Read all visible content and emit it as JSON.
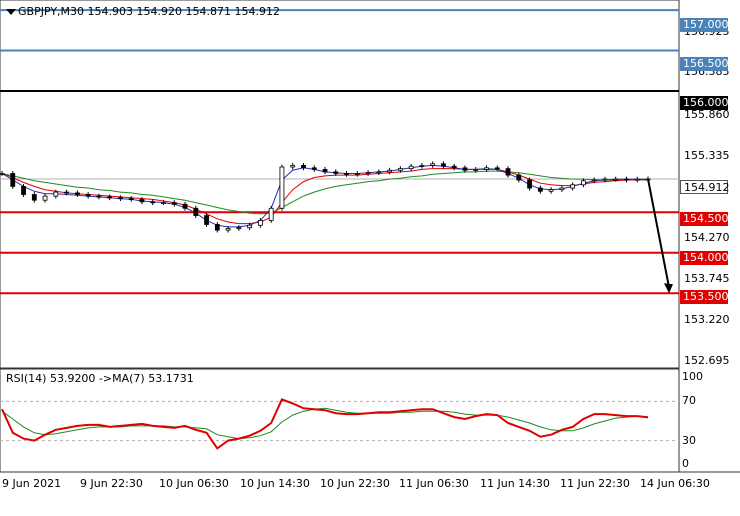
{
  "header": {
    "symbol_line": "GBPJPY,M30  154.903 154.920 154.871 154.912"
  },
  "rsi_header": {
    "label": "RSI(14) 53.9200  ->MA(7) 53.1731"
  },
  "price_axis": {
    "ticks": [
      "156.925",
      "156.385",
      "155.860",
      "155.335",
      "154.270",
      "153.745",
      "153.220",
      "152.695"
    ]
  },
  "price_badges": [
    {
      "label": "157.000",
      "kind": "blue"
    },
    {
      "label": "156.500",
      "kind": "blue"
    },
    {
      "label": "156.000",
      "kind": "black"
    },
    {
      "label": "154.912",
      "kind": "current"
    },
    {
      "label": "154.500",
      "kind": "red"
    },
    {
      "label": "154.000",
      "kind": "red"
    },
    {
      "label": "153.500",
      "kind": "red"
    }
  ],
  "rsi_axis": {
    "ticks": [
      "100",
      "70",
      "30",
      "0"
    ]
  },
  "time_axis": {
    "labels": [
      "9 Jun 2021",
      "9 Jun 22:30",
      "10 Jun 06:30",
      "10 Jun 14:30",
      "10 Jun 22:30",
      "11 Jun 06:30",
      "11 Jun 14:30",
      "11 Jun 22:30",
      "14 Jun 06:30"
    ]
  },
  "chart_data": {
    "type": "line",
    "symbol": "GBPJPY",
    "timeframe": "M30",
    "ohlc_header": {
      "open": 154.903,
      "high": 154.92,
      "low": 154.871,
      "close": 154.912
    },
    "horizontal_levels": [
      {
        "price": 157.0,
        "color": "#4a83b8"
      },
      {
        "price": 156.5,
        "color": "#4a83b8"
      },
      {
        "price": 156.0,
        "color": "#000000"
      },
      {
        "price": 154.5,
        "color": "#e00000"
      },
      {
        "price": 154.0,
        "color": "#e00000"
      },
      {
        "price": 153.5,
        "color": "#e00000"
      }
    ],
    "forecast_arrow": {
      "from": 154.912,
      "to": 153.5
    },
    "price_ylim": [
      152.6,
      157.1
    ],
    "x_labels": [
      "9 Jun 2021",
      "9 Jun 22:30",
      "10 Jun 06:30",
      "10 Jun 14:30",
      "10 Jun 22:30",
      "11 Jun 06:30",
      "11 Jun 14:30",
      "11 Jun 22:30",
      "14 Jun 06:30"
    ],
    "close_series": [
      154.98,
      154.82,
      154.72,
      154.65,
      154.7,
      154.75,
      154.74,
      154.72,
      154.7,
      154.69,
      154.68,
      154.67,
      154.66,
      154.63,
      154.62,
      154.62,
      154.6,
      154.55,
      154.46,
      154.35,
      154.28,
      154.3,
      154.31,
      154.34,
      154.4,
      154.55,
      155.06,
      155.08,
      155.05,
      155.03,
      155.0,
      154.98,
      154.97,
      154.98,
      154.99,
      155.0,
      155.02,
      155.04,
      155.07,
      155.08,
      155.1,
      155.07,
      155.05,
      155.02,
      155.03,
      155.05,
      155.04,
      154.96,
      154.9,
      154.8,
      154.76,
      154.78,
      154.8,
      154.84,
      154.89,
      154.9,
      154.91,
      154.91,
      154.9,
      154.91,
      154.912
    ],
    "ma_fast": [
      154.98,
      154.9,
      154.82,
      154.76,
      154.73,
      154.73,
      154.72,
      154.71,
      154.7,
      154.69,
      154.68,
      154.67,
      154.66,
      154.64,
      154.63,
      154.62,
      154.6,
      154.56,
      154.49,
      154.4,
      154.34,
      154.32,
      154.32,
      154.34,
      154.4,
      154.55,
      154.9,
      155.02,
      155.05,
      155.03,
      155.0,
      154.99,
      154.98,
      154.98,
      154.99,
      155.0,
      155.01,
      155.03,
      155.05,
      155.07,
      155.08,
      155.07,
      155.05,
      155.03,
      155.03,
      155.04,
      155.03,
      154.98,
      154.92,
      154.84,
      154.79,
      154.78,
      154.79,
      154.82,
      154.86,
      154.89,
      154.9,
      154.91,
      154.91,
      154.91,
      154.91
    ],
    "ma_mid": [
      154.98,
      154.93,
      154.87,
      154.82,
      154.78,
      154.76,
      154.74,
      154.73,
      154.72,
      154.71,
      154.7,
      154.69,
      154.68,
      154.67,
      154.66,
      154.64,
      154.62,
      154.59,
      154.54,
      154.48,
      154.42,
      154.38,
      154.36,
      154.36,
      154.38,
      154.44,
      154.62,
      154.78,
      154.88,
      154.93,
      154.95,
      154.96,
      154.96,
      154.96,
      154.97,
      154.98,
      154.99,
      155.0,
      155.01,
      155.03,
      155.04,
      155.04,
      155.04,
      155.03,
      155.03,
      155.03,
      155.03,
      155.0,
      154.96,
      154.91,
      154.86,
      154.84,
      154.83,
      154.83,
      154.85,
      154.87,
      154.88,
      154.89,
      154.9,
      154.9,
      154.91
    ],
    "ma_slow": [
      154.98,
      154.95,
      154.92,
      154.89,
      154.87,
      154.85,
      154.83,
      154.81,
      154.8,
      154.78,
      154.77,
      154.75,
      154.74,
      154.72,
      154.71,
      154.69,
      154.67,
      154.65,
      154.62,
      154.59,
      154.56,
      154.53,
      154.51,
      154.49,
      154.48,
      154.49,
      154.56,
      154.63,
      154.7,
      154.75,
      154.79,
      154.82,
      154.84,
      154.86,
      154.88,
      154.89,
      154.91,
      154.92,
      154.94,
      154.95,
      154.97,
      154.98,
      154.99,
      155.0,
      155.0,
      155.01,
      155.01,
      155.0,
      154.99,
      154.97,
      154.95,
      154.93,
      154.92,
      154.91,
      154.91,
      154.9,
      154.9,
      154.9,
      154.9,
      154.9,
      154.9
    ],
    "rsi": {
      "period": 14,
      "value": 53.92,
      "ma_period": 7,
      "ma_value": 53.1731,
      "ylim": [
        0,
        100
      ],
      "levels": [
        70,
        30
      ],
      "values": [
        62,
        38,
        32,
        30,
        36,
        41,
        43,
        45,
        46,
        46,
        44,
        45,
        46,
        47,
        45,
        44,
        43,
        45,
        41,
        38,
        22,
        30,
        32,
        35,
        40,
        48,
        72,
        68,
        63,
        62,
        61,
        58,
        57,
        57,
        58,
        59,
        59,
        60,
        61,
        62,
        62,
        58,
        54,
        52,
        55,
        57,
        56,
        48,
        44,
        40,
        34,
        36,
        41,
        44,
        52,
        57,
        57,
        56,
        55,
        55,
        53.92
      ],
      "ma_values": [
        60,
        52,
        44,
        38,
        36,
        37,
        39,
        41,
        43,
        44,
        44,
        44,
        45,
        45,
        45,
        45,
        44,
        44,
        43,
        42,
        36,
        34,
        32,
        33,
        35,
        39,
        49,
        56,
        60,
        62,
        63,
        61,
        59,
        58,
        58,
        58,
        58,
        59,
        59,
        60,
        60,
        60,
        59,
        57,
        56,
        56,
        56,
        54,
        51,
        48,
        44,
        41,
        40,
        40,
        43,
        47,
        50,
        53,
        54,
        55,
        53.17
      ]
    }
  }
}
